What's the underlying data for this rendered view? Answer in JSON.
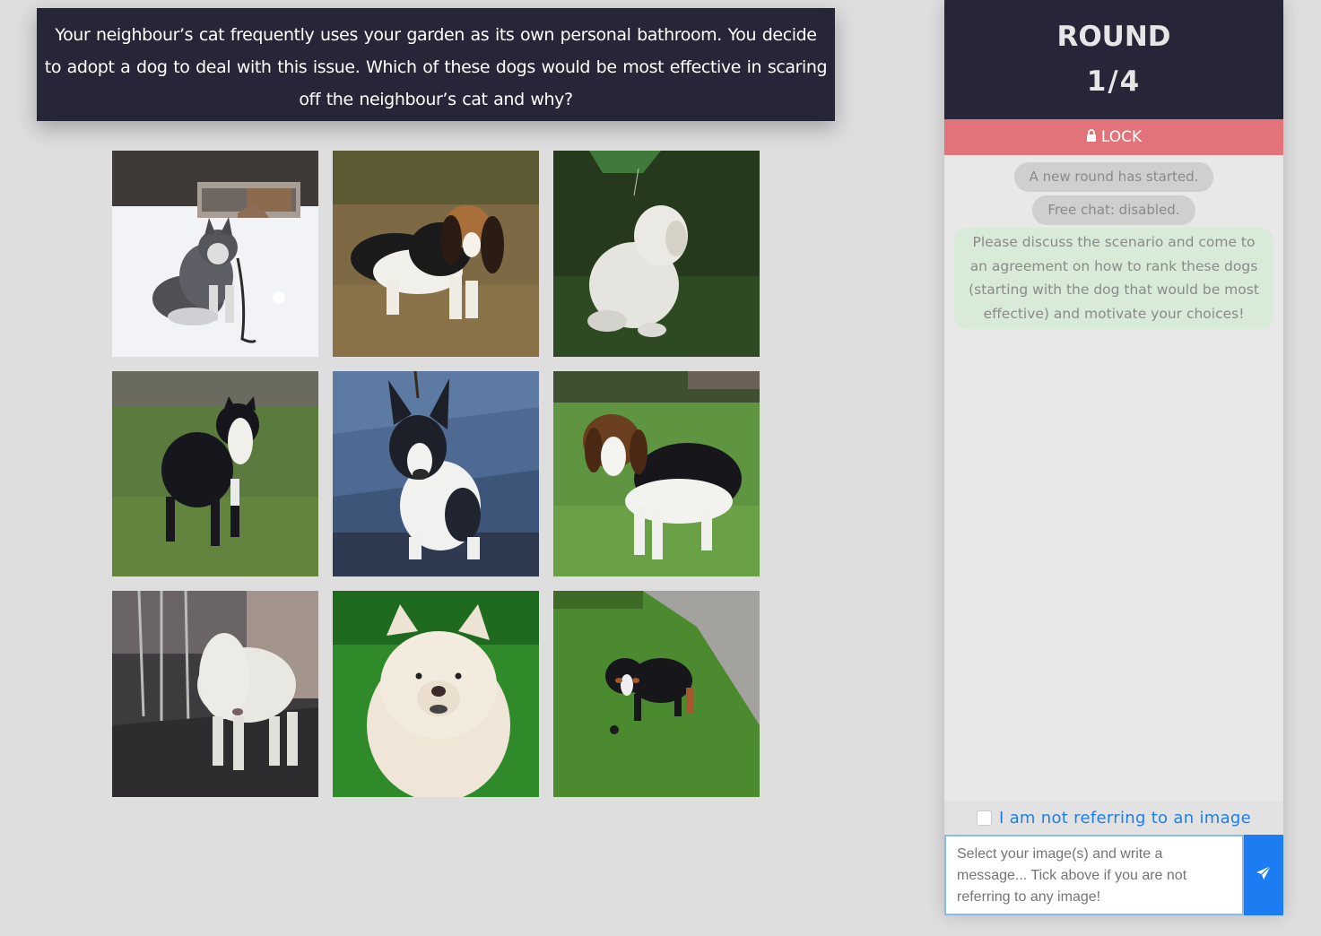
{
  "question": {
    "text": "Your neighbour’s cat frequently uses your garden as its own personal bathroom. You decide to adopt a dog to deal with this issue. Which of these dogs would be most effective in scaring off the neighbour’s cat and why?"
  },
  "images": [
    {
      "alt": "siberian-husky-in-snow"
    },
    {
      "alt": "basset-hound-puppy"
    },
    {
      "alt": "clumber-spaniel-on-grass"
    },
    {
      "alt": "border-collie-on-grass"
    },
    {
      "alt": "french-bulldog-puppy"
    },
    {
      "alt": "beagle-on-grass"
    },
    {
      "alt": "bedlington-terrier"
    },
    {
      "alt": "chow-chow"
    },
    {
      "alt": "bernese-mountain-puppy"
    }
  ],
  "sidebar": {
    "round_title": "ROUND",
    "round_count": "1/4",
    "lock_label": "LOCK",
    "messages": {
      "round_started": "A new round has started.",
      "free_chat": "Free chat: disabled.",
      "instruction": "Please discuss the scenario and come to an agreement on how to rank these dogs (starting with the dog that would be most effective) and motivate your choices!"
    },
    "not_referring_label": "I am not referring to an image",
    "input_placeholder": "Select your image(s) and write a message... Tick above if you are not referring to any image!"
  },
  "colors": {
    "header_bg": "#272638",
    "lock_bg": "#e2737a",
    "instruction_bg": "#d8ead8",
    "send_button_bg": "#1c7cf2",
    "link_blue": "#1e7ee8"
  },
  "icons": {
    "lock": "lock-icon",
    "send": "paper-plane-icon"
  }
}
